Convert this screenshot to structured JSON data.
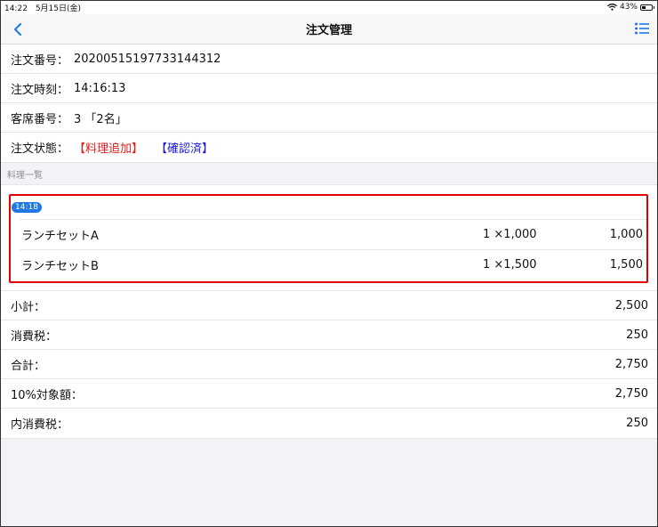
{
  "status_bar": {
    "time": "14:22",
    "date": "5月15日(金)",
    "battery": "43%"
  },
  "nav": {
    "title": "注文管理",
    "back_icon": "chevron-left-icon",
    "menu_icon": "list-icon",
    "accent_color": "#1e78e6"
  },
  "info": {
    "order_number_label": "注文番号：",
    "order_number": "20200515197733144312",
    "order_time_label": "注文時刻：",
    "order_time": "14:16:13",
    "seat_label": "客席番号：",
    "seat": "3 「2名」",
    "status_label": "注文状態：",
    "status_added": "【料理追加】",
    "status_confirmed": "【確認済】",
    "status_added_color": "#e01b1b",
    "status_confirmed_color": "#1a1adb"
  },
  "section": {
    "title": "料理一覧"
  },
  "order_group": {
    "time": "14:18",
    "items": [
      {
        "name": "ランチセットA",
        "qty": "1 ×1,000",
        "total": "1,000"
      },
      {
        "name": "ランチセットB",
        "qty": "1 ×1,500",
        "total": "1,500"
      }
    ]
  },
  "totals": [
    {
      "label": "小計：",
      "value": "2,500"
    },
    {
      "label": "消費税：",
      "value": "250"
    },
    {
      "label": "合計：",
      "value": "2,750"
    },
    {
      "label": "10%対象額：",
      "value": "2,750"
    },
    {
      "label": "内消費税：",
      "value": "250"
    }
  ]
}
